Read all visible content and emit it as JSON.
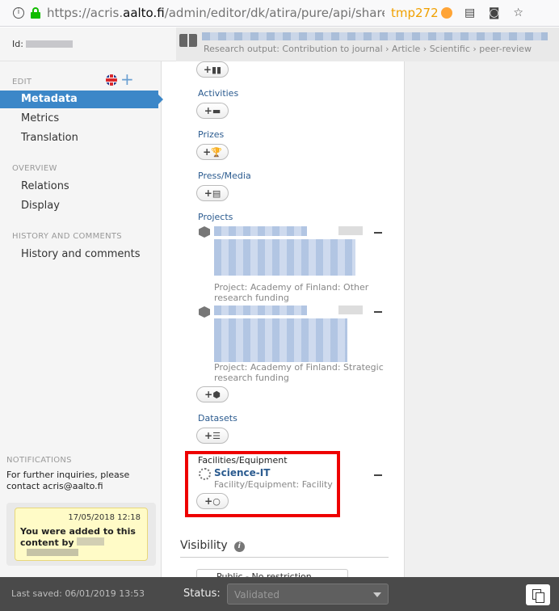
{
  "browser": {
    "url_prefix": "https://acris.",
    "url_host": "aalto.fi",
    "url_rest": "/admin/editor/dk/atira/pure/api/shared/",
    "container_label": "tmp272"
  },
  "header": {
    "id_label": "Id:",
    "breadcrumb": "Research output: Contribution to journal › Article › Scientific › peer-review"
  },
  "sidebar": {
    "edit_heading": "EDIT",
    "active_item": "Metadata",
    "items_edit": [
      "Metrics",
      "Translation"
    ],
    "overview_heading": "OVERVIEW",
    "items_overview": [
      "Relations",
      "Display"
    ],
    "history_heading": "HISTORY AND COMMENTS",
    "items_history": [
      "History and comments"
    ],
    "notifications_heading": "NOTIFICATIONS",
    "notifications_text": "For further inquiries, please contact acris@aalto.fi",
    "notification_date": "17/05/2018 12:18",
    "notification_message": "You were added to this content by"
  },
  "main": {
    "sections": {
      "activities": "Activities",
      "prizes": "Prizes",
      "press": "Press/Media",
      "projects": "Projects",
      "datasets": "Datasets",
      "facilities": "Facilities/Equipment"
    },
    "projects": [
      {
        "subtitle": "Project: Academy of Finland: Other research funding"
      },
      {
        "subtitle": "Project: Academy of Finland: Strategic research funding"
      }
    ],
    "facility": {
      "name": "Science-IT",
      "subtitle": "Facility/Equipment: Facility"
    },
    "visibility_title": "Visibility",
    "visibility_value": "Public - No restriction"
  },
  "footer": {
    "last_saved": "Last saved: 06/01/2019 13:53",
    "status_label": "Status:",
    "status_value": "Validated"
  }
}
